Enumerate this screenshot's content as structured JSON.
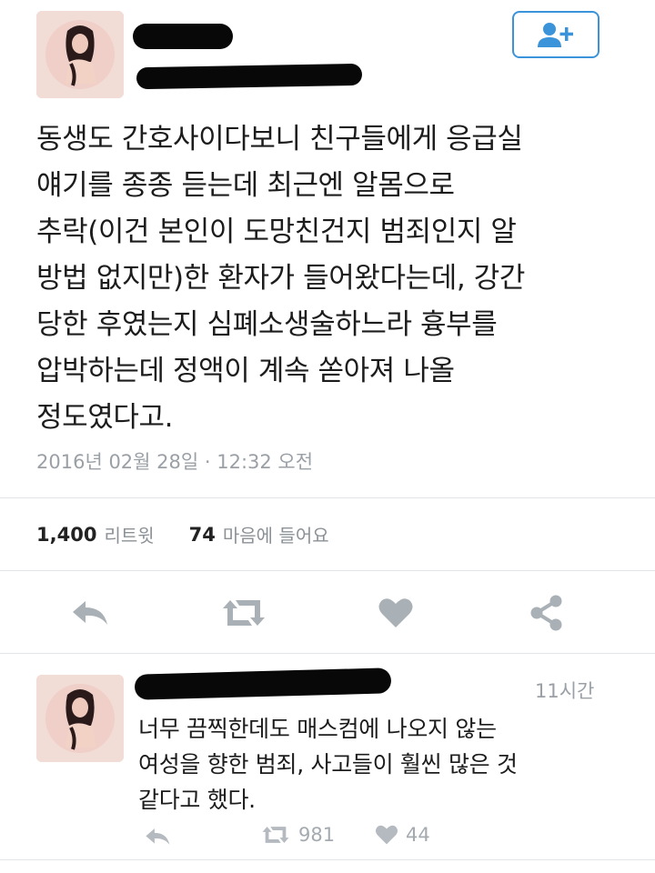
{
  "tweet": {
    "text": "동생도 간호사이다보니 친구들에게 응급실\n얘기를 종종 듣는데 최근엔 알몸으로\n추락(이건 본인이 도망친건지 범죄인지 알\n방법 없지만)한 환자가 들어왔다는데, 강간\n당한 후였는지 심폐소생술하느라 흉부를\n압박하는데 정액이 계속 쏟아져 나올\n정도였다고.",
    "timestamp": "2016년 02월 28일 · 12:32 오전",
    "retweet_count": "1,400",
    "retweet_label": "리트윗",
    "like_count": "74",
    "like_label": "마음에 들어요"
  },
  "reply": {
    "time": "11시간",
    "text": "너무 끔찍한데도 매스컴에 나오지 않는\n여성을 향한 범죄, 사고들이 훨씬 많은 것\n같다고 했다.",
    "retweet_count": "981",
    "like_count": "44"
  },
  "icons": {
    "follow": "add-user-icon",
    "reply": "reply-icon",
    "retweet": "retweet-icon",
    "like": "heart-icon",
    "share": "share-icon"
  },
  "colors": {
    "accent": "#3b94d9",
    "icon_gray": "#a9b0b6",
    "meta_gray": "#9aa0a6",
    "redaction": "#080808"
  }
}
